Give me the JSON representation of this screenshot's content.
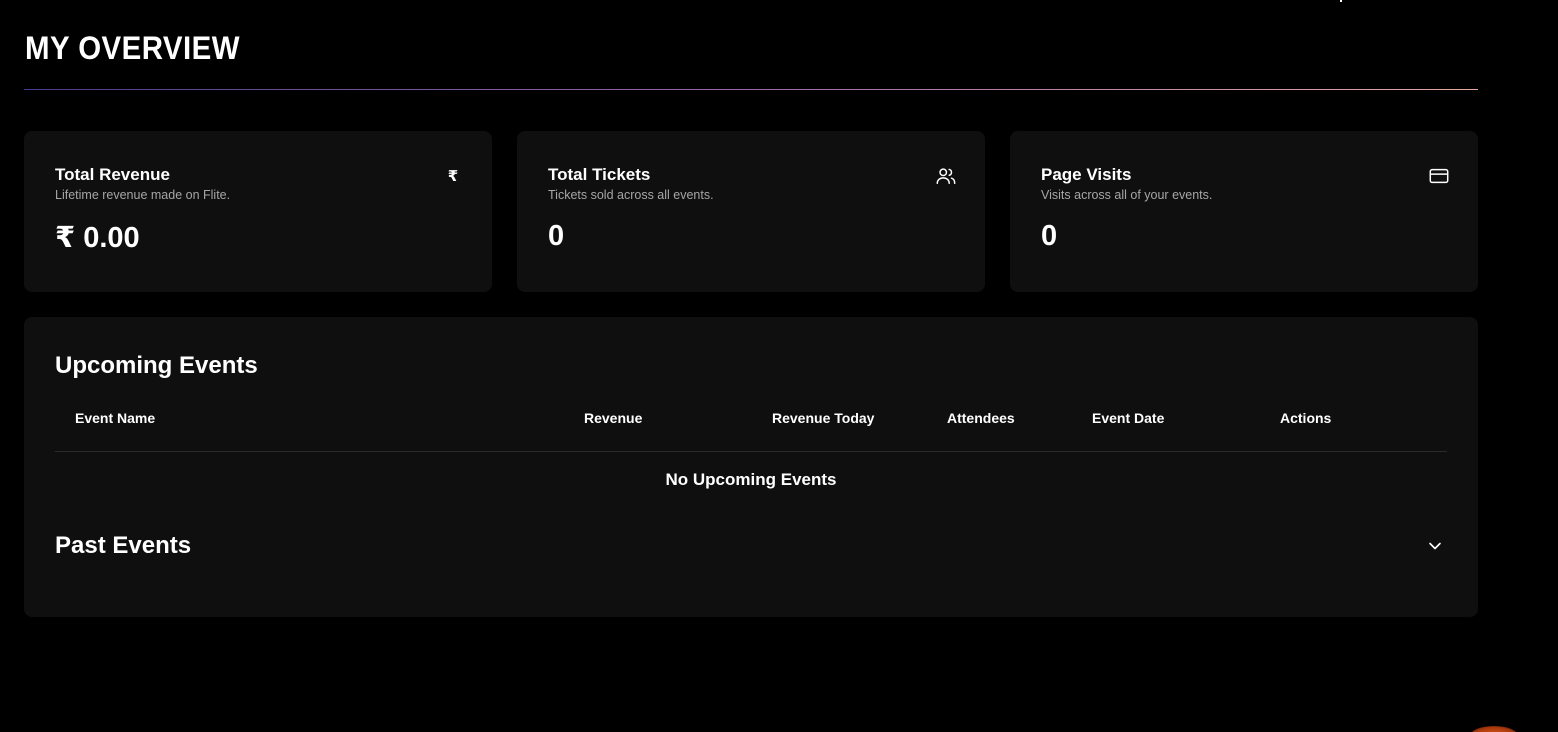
{
  "page": {
    "title": "MY OVERVIEW"
  },
  "stats": [
    {
      "title": "Total Revenue",
      "subtitle": "Lifetime revenue made on Flite.",
      "value": "₹ 0.00",
      "icon": "rupee-icon",
      "icon_glyph": "₹"
    },
    {
      "title": "Total Tickets",
      "subtitle": "Tickets sold across all events.",
      "value": "0",
      "icon": "users-icon"
    },
    {
      "title": "Page Visits",
      "subtitle": "Visits across all of your events.",
      "value": "0",
      "icon": "credit-card-icon"
    }
  ],
  "upcoming": {
    "title": "Upcoming Events",
    "columns": [
      "Event Name",
      "Revenue",
      "Revenue Today",
      "Attendees",
      "Event Date",
      "Actions"
    ],
    "empty_message": "No Upcoming Events"
  },
  "past": {
    "title": "Past Events",
    "toggle_icon": "chevron-down-icon"
  },
  "colors": {
    "background": "#000000",
    "card": "#0f0f0f",
    "muted_text": "#a6a6a6",
    "divider_gradient_start": "#4b3a8a",
    "divider_gradient_end": "#e6a7a0",
    "accent_orange": "#e05a1a"
  }
}
